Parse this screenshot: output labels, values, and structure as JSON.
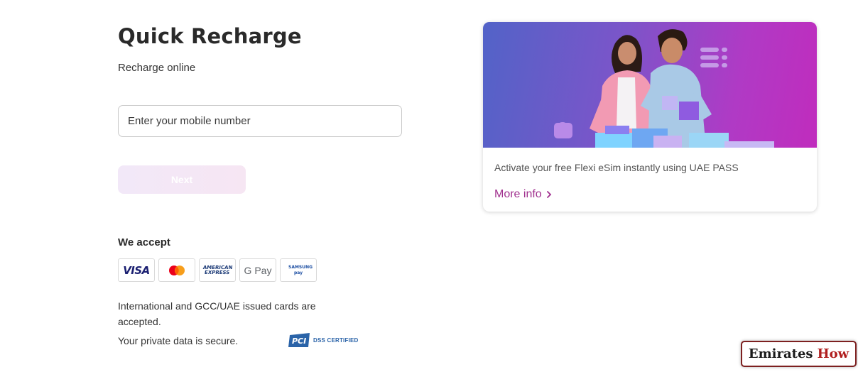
{
  "page": {
    "title": "Quick Recharge",
    "subtitle": "Recharge online"
  },
  "form": {
    "mobile_placeholder": "Enter your mobile number",
    "mobile_value": "",
    "next_label": "Next"
  },
  "payments": {
    "heading": "We accept",
    "methods": [
      {
        "name": "VISA",
        "icon": "visa-icon"
      },
      {
        "name": "Mastercard",
        "icon": "mastercard-icon"
      },
      {
        "name": "AMERICAN EXPRESS",
        "icon": "amex-icon"
      },
      {
        "name": "G Pay",
        "icon": "google-pay-icon"
      },
      {
        "name": "SAMSUNG pay",
        "icon": "samsung-pay-icon"
      }
    ],
    "cards_note": "International and GCC/UAE issued cards are accepted.",
    "secure_note": "Your private data is secure.",
    "pci_label": "DSS CERTIFIED"
  },
  "promo": {
    "text": "Activate your free Flexi eSim instantly using UAE PASS",
    "link_label": "More info",
    "gradient": [
      "#5263c8",
      "#c02cbd"
    ],
    "link_color": "#a0308e"
  },
  "watermark": {
    "part1": "Emirates",
    "part2": "How"
  }
}
